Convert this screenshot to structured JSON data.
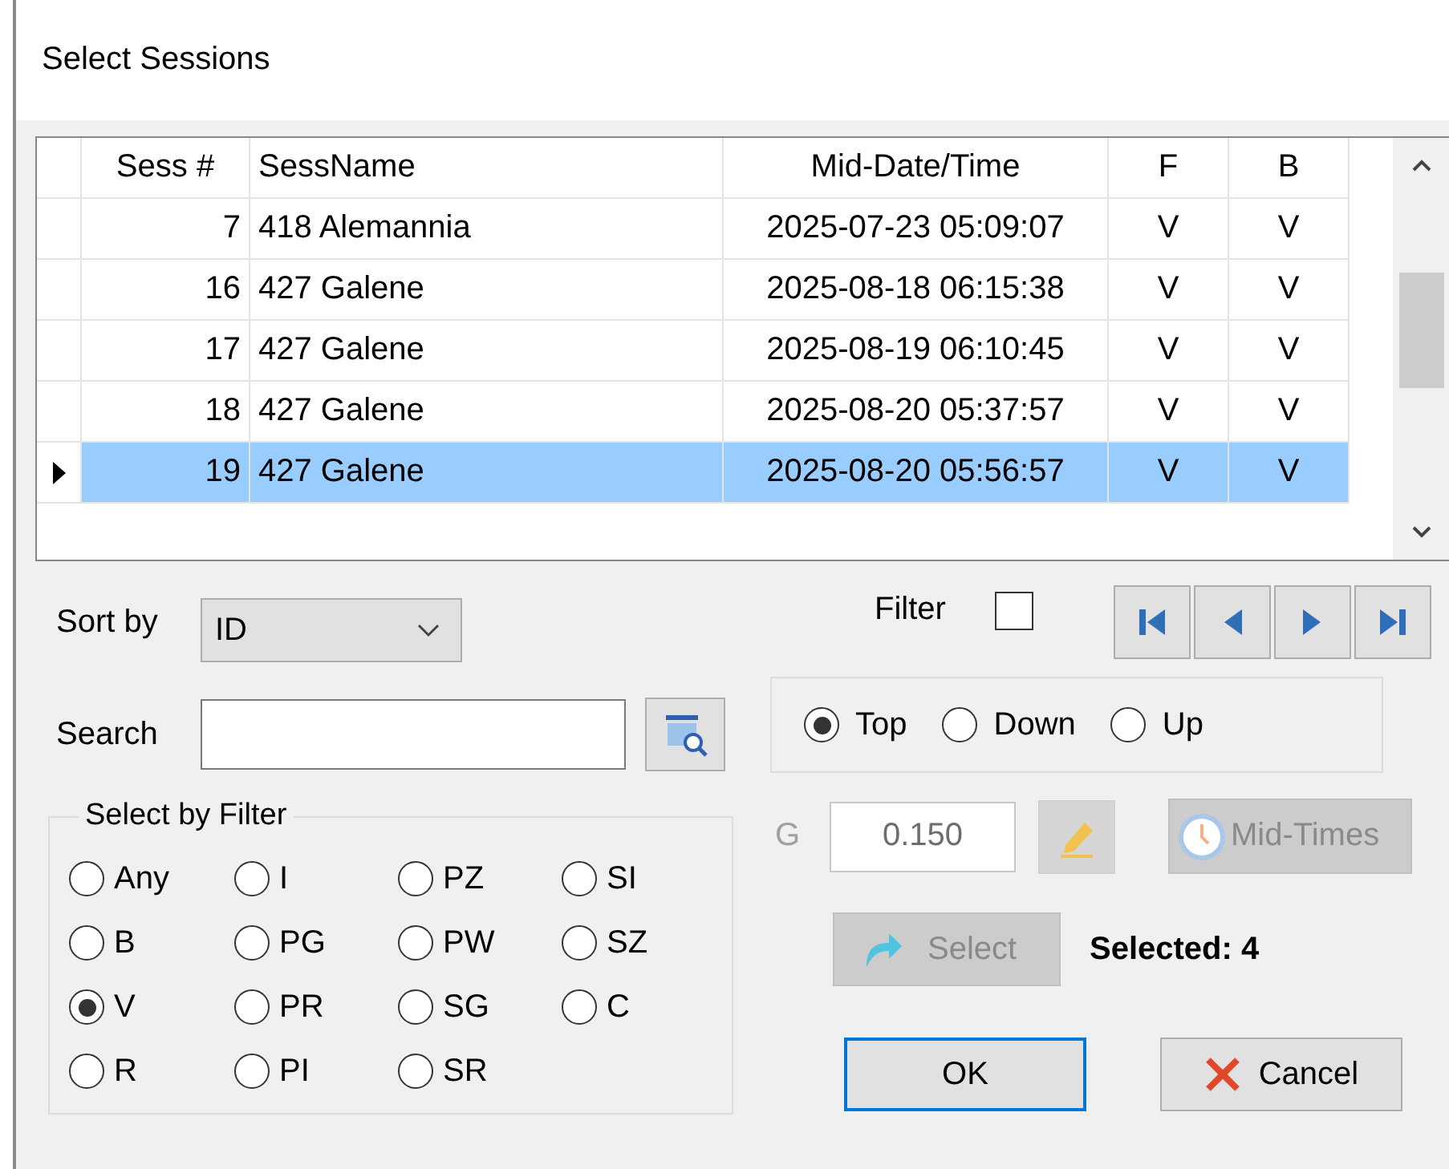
{
  "window": {
    "title": "Select Sessions"
  },
  "table": {
    "columns": [
      "Sess #",
      "SessName",
      "Mid-Date/Time",
      "F",
      "B"
    ],
    "rows": [
      {
        "cells": [
          "7",
          "418 Alemannia",
          "2025-07-23 05:09:07",
          "V",
          "V"
        ],
        "selected": false
      },
      {
        "cells": [
          "16",
          "427 Galene",
          "2025-08-18 06:15:38",
          "V",
          "V"
        ],
        "selected": false
      },
      {
        "cells": [
          "17",
          "427 Galene",
          "2025-08-19 06:10:45",
          "V",
          "V"
        ],
        "selected": false
      },
      {
        "cells": [
          "18",
          "427 Galene",
          "2025-08-20 05:37:57",
          "V",
          "V"
        ],
        "selected": false
      },
      {
        "cells": [
          "19",
          "427 Galene",
          "2025-08-20 05:56:57",
          "V",
          "V"
        ],
        "selected": true
      }
    ]
  },
  "sort_by": {
    "label": "Sort by",
    "value": "ID"
  },
  "filter": {
    "label": "Filter",
    "checked": false
  },
  "search": {
    "label": "Search"
  },
  "direction": [
    {
      "label": "Top",
      "selected": true
    },
    {
      "label": "Down",
      "selected": false
    },
    {
      "label": "Up",
      "selected": false
    }
  ],
  "select_by_filter": {
    "title": "Select by Filter",
    "options": [
      {
        "label": "Any",
        "selected": false
      },
      {
        "label": "I",
        "selected": false
      },
      {
        "label": "PZ",
        "selected": false
      },
      {
        "label": "SI",
        "selected": false
      },
      {
        "label": "B",
        "selected": false
      },
      {
        "label": "PG",
        "selected": false
      },
      {
        "label": "PW",
        "selected": false
      },
      {
        "label": "SZ",
        "selected": false
      },
      {
        "label": "V",
        "selected": true
      },
      {
        "label": "PR",
        "selected": false
      },
      {
        "label": "SG",
        "selected": false
      },
      {
        "label": "C",
        "selected": false
      },
      {
        "label": "R",
        "selected": false
      },
      {
        "label": "PI",
        "selected": false
      },
      {
        "label": "SR",
        "selected": false
      }
    ]
  },
  "g": {
    "label": "G",
    "value": "0.150",
    "disabled": true
  },
  "mid_times_button": {
    "label": "Mid-Times",
    "disabled": true
  },
  "select_button": {
    "label": "Select",
    "disabled": true
  },
  "selected_count": "Selected: 4",
  "buttons": [
    {
      "label": "OK",
      "kind": "default"
    },
    {
      "label": "Cancel",
      "kind": "cancel"
    }
  ]
}
